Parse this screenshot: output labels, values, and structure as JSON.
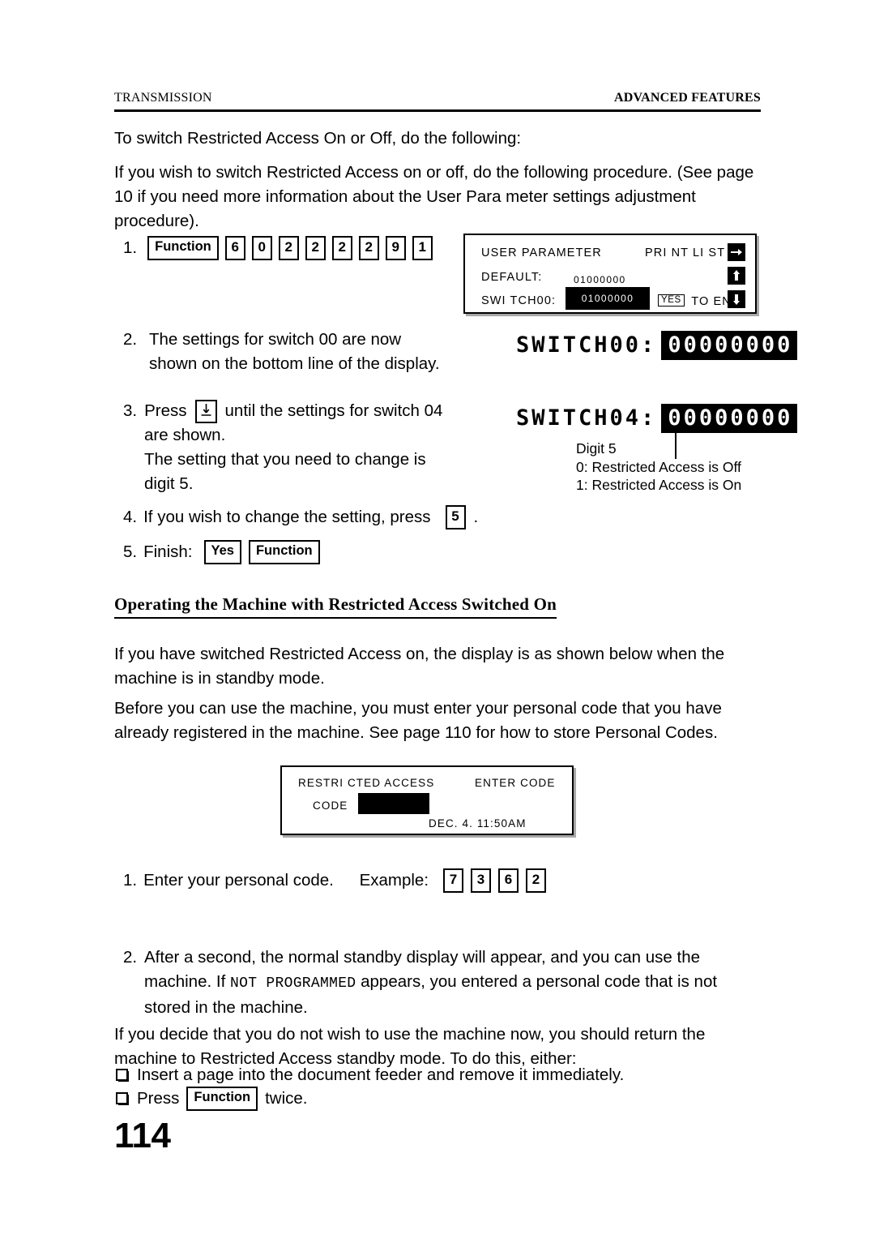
{
  "header": {
    "left": "TRANSMISSION",
    "right": "ADVANCED FEATURES"
  },
  "intro": {
    "line1": "To switch Restricted Access On or Off, do the following:",
    "paragraph": "If you wish to switch Restricted Access on or off, do the following procedure. (See page 10 if you need more information about the User Para  meter settings adjustment procedure)."
  },
  "steps_switch": [
    {
      "num": "1.",
      "keys": [
        {
          "label": "Function",
          "type": "word"
        },
        {
          "label": "6",
          "type": "digit"
        },
        {
          "label": "0",
          "type": "digit"
        },
        {
          "label": "2",
          "type": "digit"
        },
        {
          "label": "2",
          "type": "digit"
        },
        {
          "label": "2",
          "type": "digit"
        },
        {
          "label": "2",
          "type": "digit"
        },
        {
          "label": "9",
          "type": "digit"
        },
        {
          "label": "1",
          "type": "digit"
        }
      ]
    },
    {
      "num": "2.",
      "line1": "The settings for switch 00 are now",
      "line2": "shown on the bottom line of the display."
    },
    {
      "num": "3.",
      "pre": "Press",
      "key": "down-arrow",
      "post": "until the settings for switch 04",
      "line2": "are shown.",
      "line3": "The setting that you need to change is",
      "line4": "digit 5."
    },
    {
      "num": "4.",
      "pre": "If you wish to change the setting, press",
      "key": "5",
      "post": "."
    },
    {
      "num": "5.",
      "pre": "Finish:",
      "key1": "Yes",
      "key2": "Function"
    }
  ],
  "lcd_user_parameter": {
    "title": "USER PARAMETER",
    "print_list": "PRI NT LI ST",
    "default_label": "DEFAULT:",
    "default_value": "01000000",
    "switch_label": "SWI TCH00:",
    "switch_value": "01000000",
    "yes_key": "YES",
    "to_end": "TO END",
    "buttons": [
      "right-arrow-icon",
      "up-arrow-icon",
      "down-arrow-icon"
    ]
  },
  "display_switch00": {
    "label": "SWITCH00:",
    "value": "00000000"
  },
  "display_switch04": {
    "label": "SWITCH04:",
    "value": "00000000"
  },
  "callout": {
    "line1": "Digit 5",
    "line2": "0: Restricted Access is Off",
    "line3": "1: Restricted Access is On"
  },
  "section": {
    "heading": "Operating the Machine with Restricted Access Switched On",
    "para1": "If you have switched Restricted Access on, the display is as shown below when the machine is in standby mode.",
    "para2": "Before you can use the machine, you must enter your personal code that you have already registered in the machine. See page  110 for how to store Personal Codes."
  },
  "lcd_restricted": {
    "title": "RESTRI CTED ACCESS",
    "enter_code": "ENTER CODE",
    "code_label": "CODE",
    "code_value": "",
    "datetime": "DEC. 4. 11:50AM"
  },
  "steps_code": [
    {
      "num": "1.",
      "line1": "Enter your personal code.",
      "example_label": "Example:",
      "example_keys": [
        "7",
        "3",
        "6",
        "2"
      ]
    },
    {
      "num": "2.",
      "part1": "After a second, the normal standby display will appear, and you can use the machine. If",
      "mono": "NOT PROGRAMMED",
      "part2": "appears, you entered a personal code that is not stored in the machine."
    }
  ],
  "closing": {
    "para": "If you decide that you do not wish to use the machine now, you should return the machine to Restricted Access standby mode. To do this, either:",
    "bullets": [
      {
        "text": "Insert a page into the document feeder and remove it immediately."
      },
      {
        "pre": "Press",
        "key": "Function",
        "post": "twice."
      }
    ]
  },
  "page_number": "114"
}
